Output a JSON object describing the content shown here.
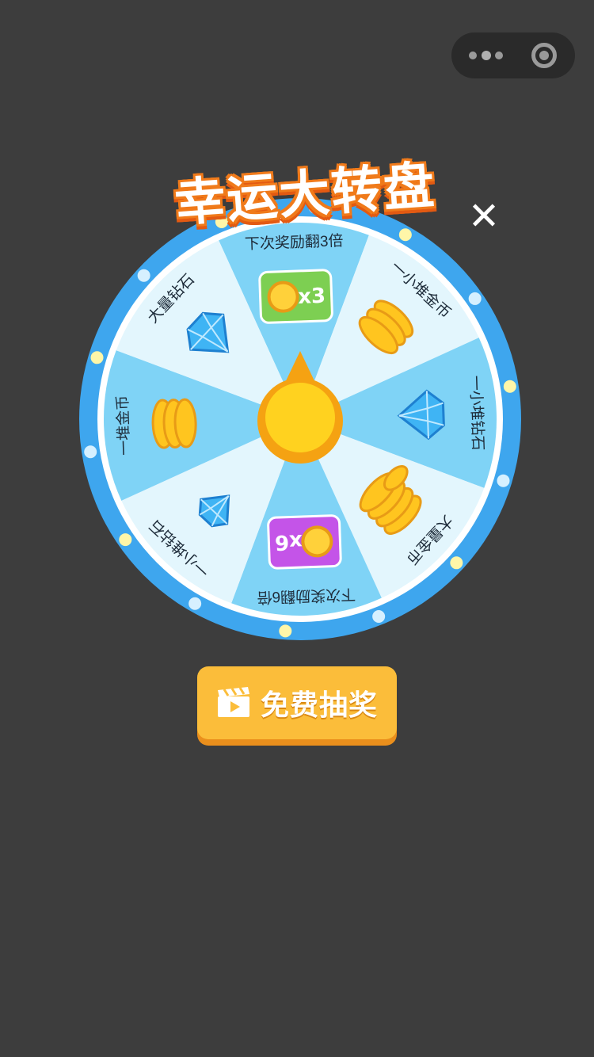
{
  "title": "幸运大转盘",
  "close_label": "✕",
  "wheel": {
    "segments": [
      {
        "label": "下次奖励翻3倍",
        "prize_icon": "coin-x3-card-icon",
        "badge": "x3"
      },
      {
        "label": "一小堆金币",
        "prize_icon": "coin-stack-small-icon"
      },
      {
        "label": "一小堆钻石",
        "prize_icon": "diamond-pile-small-icon"
      },
      {
        "label": "大量金币",
        "prize_icon": "coin-pile-large-icon"
      },
      {
        "label": "下次奖励翻6倍",
        "prize_icon": "coin-x6-card-icon",
        "badge": "x6"
      },
      {
        "label": "一小堆钻石",
        "prize_icon": "diamond-single-icon"
      },
      {
        "label": "一堆金币",
        "prize_icon": "coin-stack-icon"
      },
      {
        "label": "大量钻石",
        "prize_icon": "diamond-pile-large-icon"
      }
    ],
    "pointer_icon": "spin-pointer-icon"
  },
  "free_button": {
    "label": "免费抽奖",
    "icon": "video-clapper-icon"
  },
  "menu_capsule": {
    "more_icon": "more-dots-icon",
    "close_icon": "target-icon"
  },
  "colors": {
    "background": "#3d3d3d",
    "wheel_ring": "#3ea6ee",
    "segment_light": "#e3f6fd",
    "segment_dark": "#7fd3f6",
    "pointer": "#ffd21f",
    "button": "#fbbd3a"
  }
}
